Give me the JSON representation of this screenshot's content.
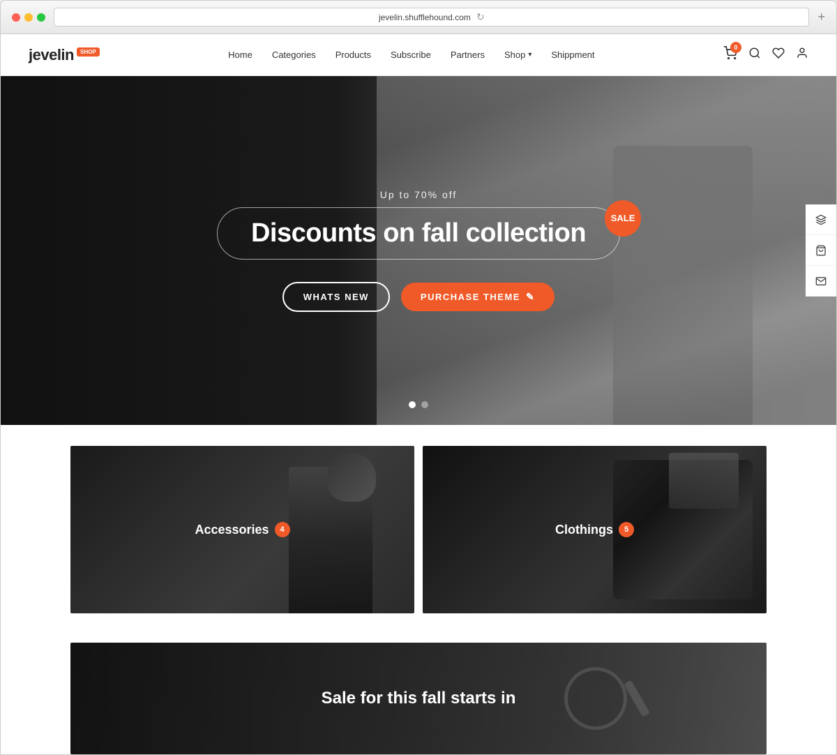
{
  "browser": {
    "url": "jevelin.shufflehound.com",
    "refresh_icon": "↻"
  },
  "header": {
    "logo_text": "jevelin",
    "logo_badge": "SHOP",
    "nav_items": [
      {
        "label": "Home",
        "id": "home"
      },
      {
        "label": "Categories",
        "id": "categories"
      },
      {
        "label": "Products",
        "id": "products"
      },
      {
        "label": "Subscribe",
        "id": "subscribe"
      },
      {
        "label": "Partners",
        "id": "partners"
      },
      {
        "label": "Shop",
        "id": "shop",
        "has_dropdown": true
      },
      {
        "label": "Shippment",
        "id": "shippment"
      }
    ],
    "cart_count": "0",
    "icons": [
      "cart",
      "search",
      "wishlist",
      "user"
    ]
  },
  "hero": {
    "subtitle": "Up to 70% off",
    "title": "Discounts on fall collection",
    "sale_badge": "Sale",
    "btn_whats_new": "WHATS NEW",
    "btn_purchase": "PURCHASE THEME",
    "dots": [
      true,
      false
    ],
    "sidebar_icons": [
      "layers",
      "shopping-bag",
      "mail"
    ]
  },
  "categories": {
    "items": [
      {
        "id": "accessories",
        "label": "Accessories",
        "count": "4"
      },
      {
        "id": "clothings",
        "label": "Clothings",
        "count": "5"
      }
    ]
  },
  "fall_sale": {
    "text": "Sale for this fall starts in"
  }
}
